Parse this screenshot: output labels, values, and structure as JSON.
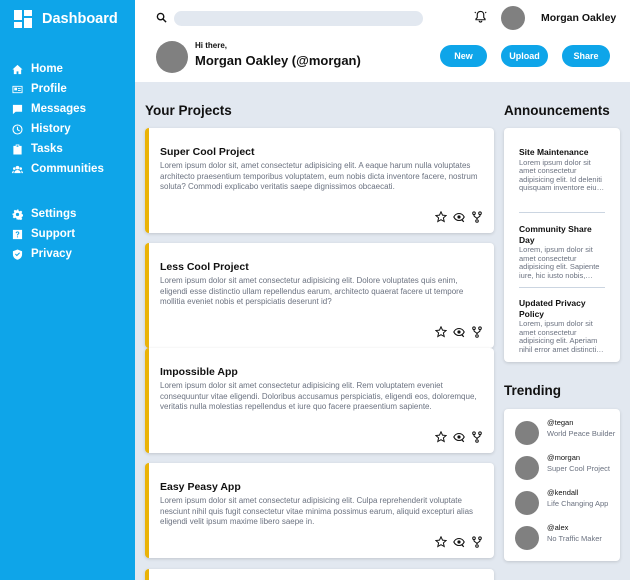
{
  "sidebar": {
    "brand": "Dashboard",
    "items": [
      {
        "label": "Home",
        "icon": "home-icon"
      },
      {
        "label": "Profile",
        "icon": "id-card-icon"
      },
      {
        "label": "Messages",
        "icon": "message-icon"
      },
      {
        "label": "History",
        "icon": "clock-icon"
      },
      {
        "label": "Tasks",
        "icon": "clipboard-icon"
      },
      {
        "label": "Communities",
        "icon": "users-icon"
      }
    ],
    "secondary": [
      {
        "label": "Settings",
        "icon": "gear-icon"
      },
      {
        "label": "Support",
        "icon": "help-icon"
      },
      {
        "label": "Privacy",
        "icon": "shield-icon"
      }
    ]
  },
  "header": {
    "search": {
      "placeholder": "",
      "value": ""
    },
    "user_name": "Morgan Oakley",
    "greeting": "Hi there,",
    "full_name": "Morgan Oakley (@morgan)",
    "buttons": {
      "new": "New",
      "upload": "Upload",
      "share": "Share"
    }
  },
  "projects": {
    "title": "Your Projects",
    "items": [
      {
        "title": "Super Cool Project",
        "body": "Lorem ipsum dolor sit, amet consectetur adipisicing elit. A eaque harum nulla voluptates architecto praesentium temporibus voluptatem, eum nobis dicta inventore facere, nostrum soluta? Commodi explicabo veritatis saepe dignissimos obcaecati."
      },
      {
        "title": "Less Cool Project",
        "body": "Lorem ipsum dolor sit amet consectetur adipisicing elit. Dolore voluptates quis enim, eligendi esse distinctio ullam repellendus earum, architecto quaerat facere ut tempore mollitia eveniet nobis et perspiciatis deserunt id?"
      },
      {
        "title": "Impossible App",
        "body": "Lorem ipsum dolor sit amet consectetur adipisicing elit. Rem voluptatem eveniet consequuntur vitae eligendi. Doloribus accusamus perspiciatis, eligendi eos, doloremque, veritatis nulla molestias repellendus et iure quo facere praesentium sapiente."
      },
      {
        "title": "Easy Peasy App",
        "body": "Lorem ipsum dolor sit amet consectetur adipisicing elit. Culpa reprehenderit voluptate nesciunt nihil quis fugit consectetur vitae minima possimus earum, aliquid excepturi alias eligendi velit ipsum maxime libero saepe in."
      }
    ]
  },
  "announcements": {
    "title": "Announcements",
    "items": [
      {
        "title": "Site Maintenance",
        "body": "Lorem ipsum dolor sit amet consectetur adipisicing elit. Id deleniti quisquam inventore eius dolorum."
      },
      {
        "title": "Community Share Day",
        "body": "Lorem, ipsum dolor sit amet consectetur adipisicing elit. Sapiente iure, hic iusto nobis, dolores."
      },
      {
        "title": "Updated Privacy Policy",
        "body": "Lorem, ipsum dolor sit amet consectetur adipisicing elit. Aperiam nihil error amet distinctio quas."
      }
    ]
  },
  "trending": {
    "title": "Trending",
    "items": [
      {
        "handle": "@tegan",
        "project": "World Peace Builder"
      },
      {
        "handle": "@morgan",
        "project": "Super Cool Project"
      },
      {
        "handle": "@kendall",
        "project": "Life Changing App"
      },
      {
        "handle": "@alex",
        "project": "No Traffic Maker"
      }
    ]
  },
  "colors": {
    "sidebar": "#0ea5e9",
    "accent": "#eab308",
    "background": "#e2e8f0"
  }
}
